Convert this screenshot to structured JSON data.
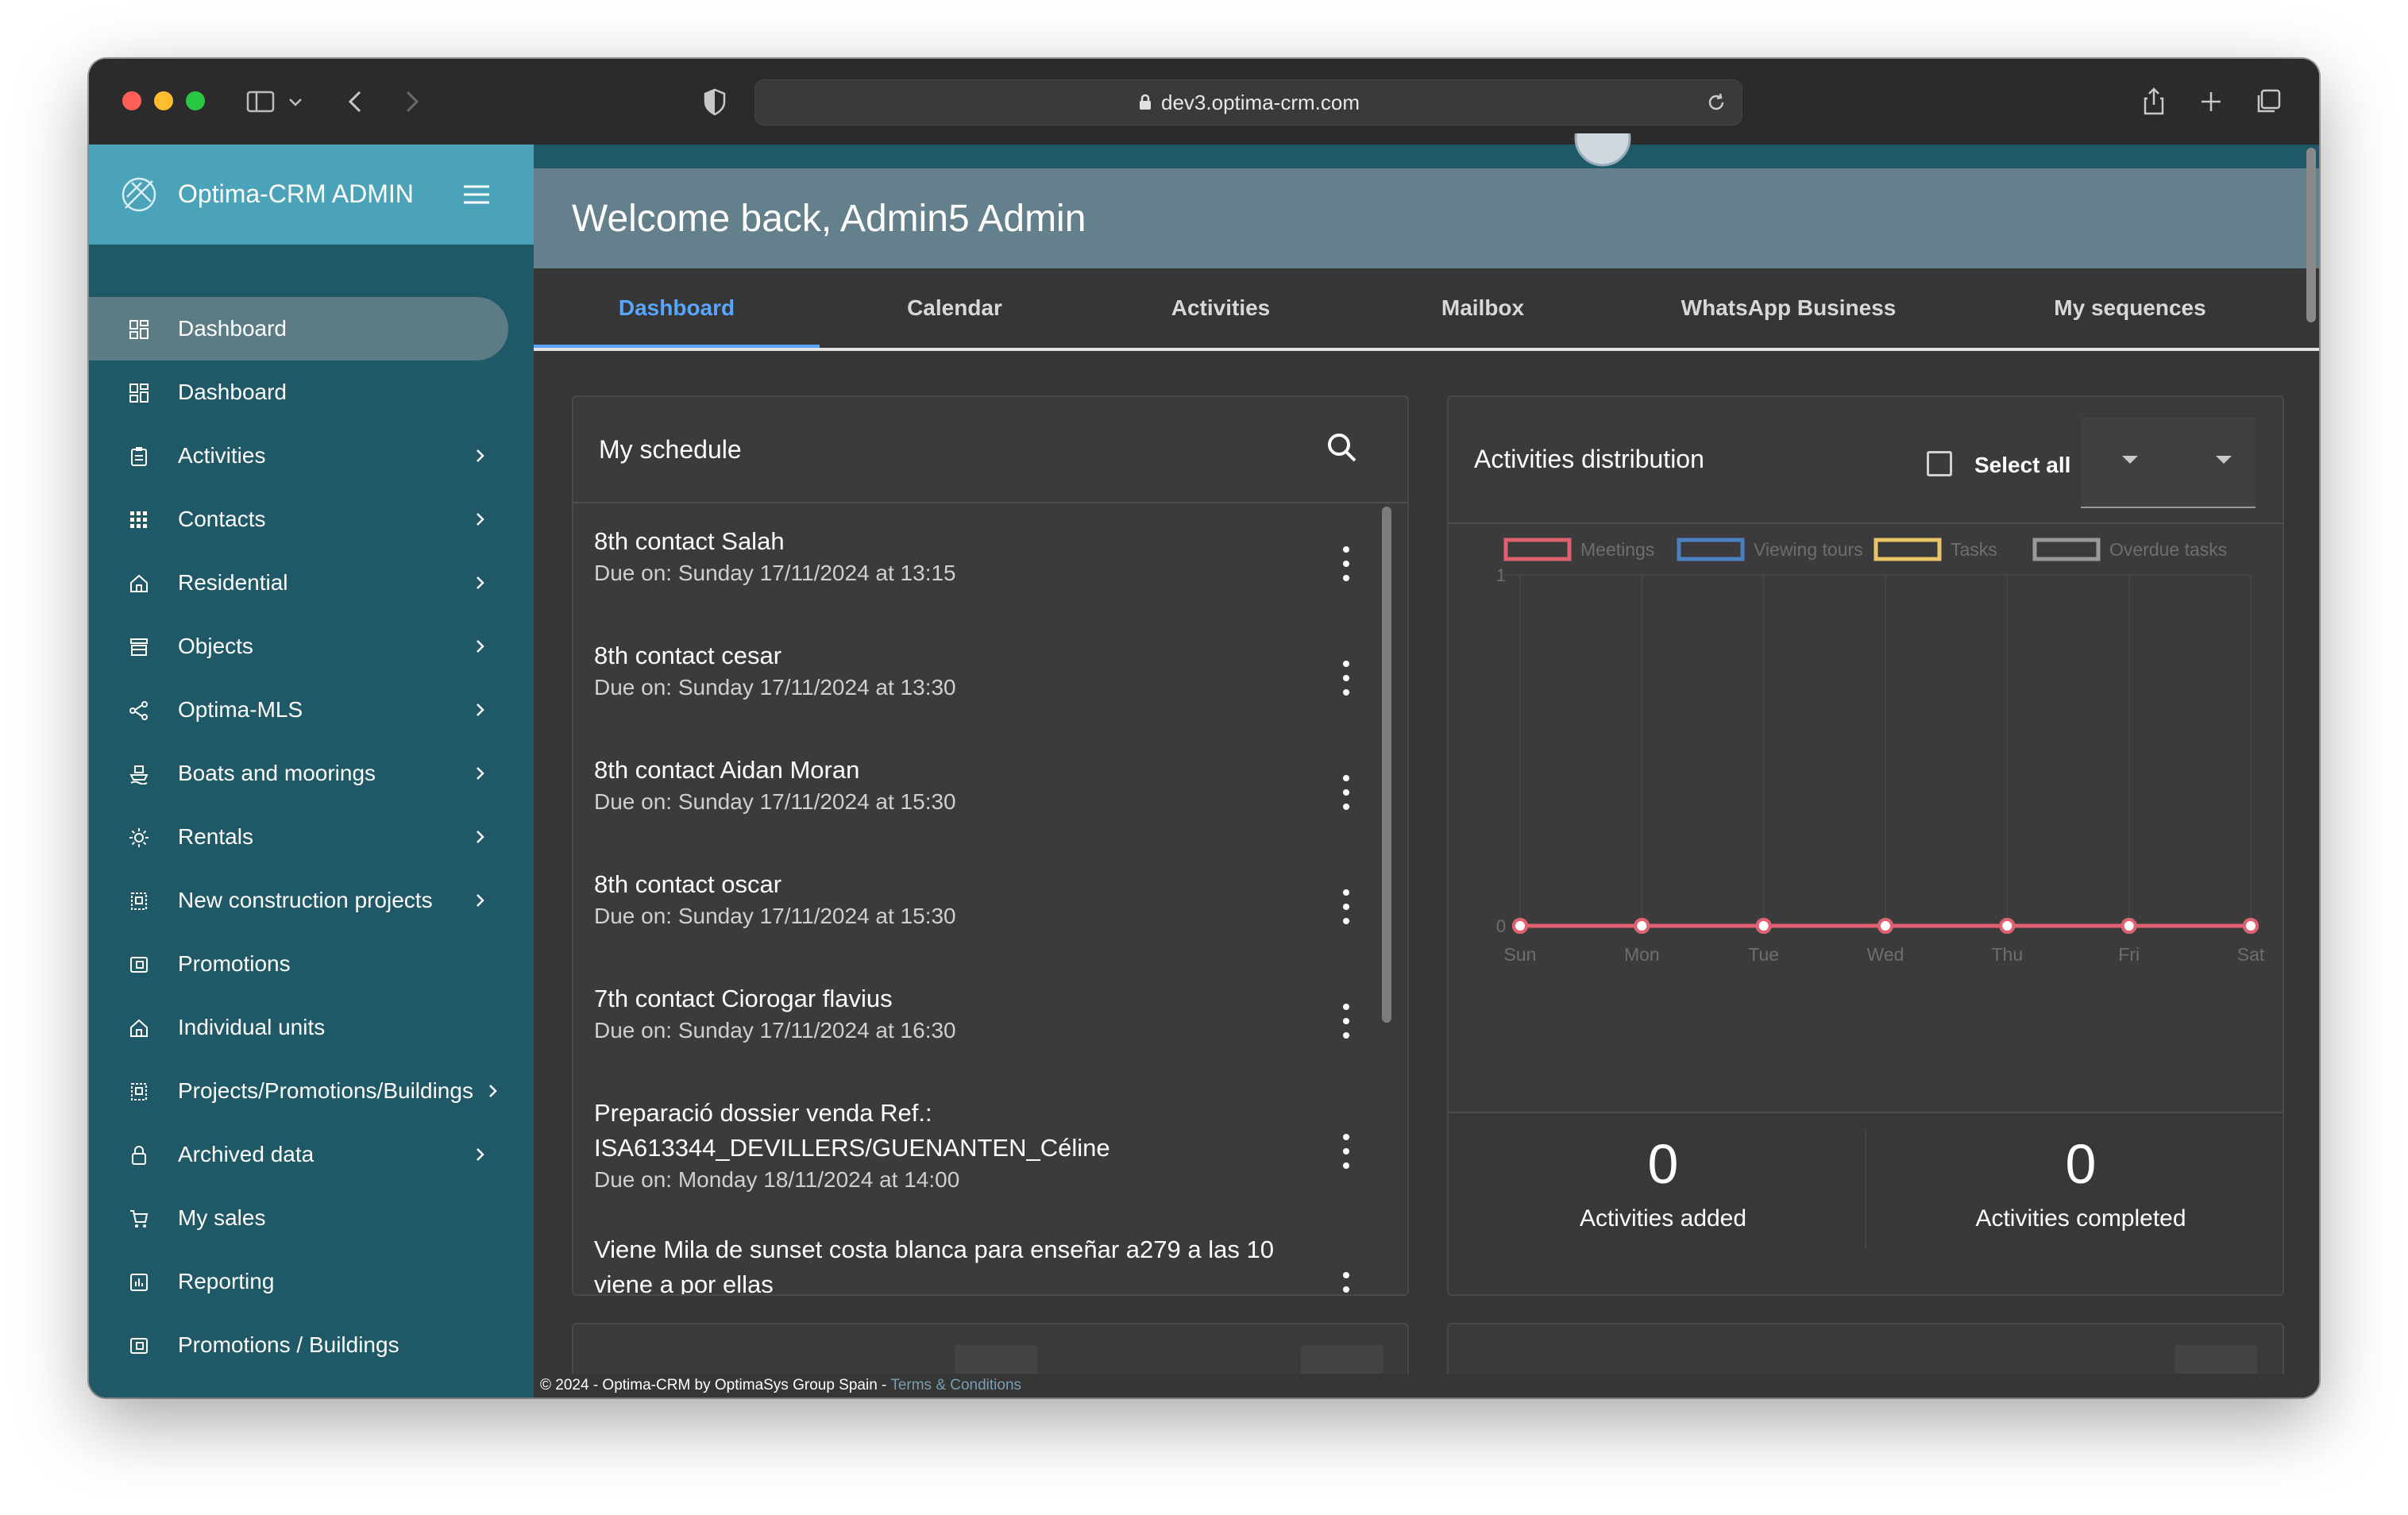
{
  "browser": {
    "url": "dev3.optima-crm.com"
  },
  "sidebar": {
    "brand": "Optima-CRM ADMIN",
    "items": [
      {
        "label": "Dashboard",
        "icon": "dashboard-icon",
        "chevron": false,
        "active": true
      },
      {
        "label": "Dashboard",
        "icon": "dashboard-icon",
        "chevron": false
      },
      {
        "label": "Activities",
        "icon": "clipboard-icon",
        "chevron": true
      },
      {
        "label": "Contacts",
        "icon": "grid-icon",
        "chevron": true
      },
      {
        "label": "Residential",
        "icon": "home-icon",
        "chevron": true
      },
      {
        "label": "Objects",
        "icon": "store-icon",
        "chevron": true
      },
      {
        "label": "Optima-MLS",
        "icon": "share-icon",
        "chevron": true
      },
      {
        "label": "Boats and moorings",
        "icon": "boat-icon",
        "chevron": true
      },
      {
        "label": "Rentals",
        "icon": "sun-icon",
        "chevron": true
      },
      {
        "label": "New construction projects",
        "icon": "building-icon",
        "chevron": true
      },
      {
        "label": "Promotions",
        "icon": "promotion-icon",
        "chevron": false
      },
      {
        "label": "Individual units",
        "icon": "home-icon",
        "chevron": false
      },
      {
        "label": "Projects/Promotions/Buildings",
        "icon": "building-icon",
        "chevron": true
      },
      {
        "label": "Archived data",
        "icon": "lock-icon",
        "chevron": true
      },
      {
        "label": "My sales",
        "icon": "cart-icon",
        "chevron": false
      },
      {
        "label": "Reporting",
        "icon": "chart-icon",
        "chevron": false
      },
      {
        "label": "Promotions / Buildings",
        "icon": "promotion-icon",
        "chevron": false
      }
    ]
  },
  "header": {
    "welcome": "Welcome back, Admin5 Admin"
  },
  "tabs": [
    {
      "label": "Dashboard",
      "active": true
    },
    {
      "label": "Calendar"
    },
    {
      "label": "Activities"
    },
    {
      "label": "Mailbox"
    },
    {
      "label": "WhatsApp Business"
    },
    {
      "label": "My sequences"
    }
  ],
  "schedule": {
    "title": "My schedule",
    "items": [
      {
        "title": "8th contact Salah",
        "due": "Due on: Sunday 17/11/2024 at 13:15"
      },
      {
        "title": "8th contact cesar",
        "due": "Due on: Sunday 17/11/2024 at 13:30"
      },
      {
        "title": "8th contact Aidan Moran",
        "due": "Due on: Sunday 17/11/2024 at 15:30"
      },
      {
        "title": "8th contact oscar",
        "due": "Due on: Sunday 17/11/2024 at 15:30"
      },
      {
        "title": "7th contact Ciorogar flavius",
        "due": "Due on: Sunday 17/11/2024 at 16:30"
      },
      {
        "title": "Preparació dossier venda Ref.: ISA613344_DEVILLERS/GUENANTEN_Céline",
        "due": "Due on: Monday 18/11/2024 at 14:00"
      },
      {
        "title": "Viene Mila de sunset costa blanca para enseñar a279 a las 10 viene a por ellas",
        "due": ""
      }
    ]
  },
  "distribution": {
    "title": "Activities distribution",
    "select_all": "Select all",
    "stats": [
      {
        "value": "0",
        "label": "Activities added"
      },
      {
        "value": "0",
        "label": "Activities completed"
      }
    ]
  },
  "chart_data": {
    "type": "line",
    "categories": [
      "Sun",
      "Mon",
      "Tue",
      "Wed",
      "Thu",
      "Fri",
      "Sat"
    ],
    "series": [
      {
        "name": "Meetings",
        "color": "#e06070",
        "values": [
          0,
          0,
          0,
          0,
          0,
          0,
          0
        ]
      },
      {
        "name": "Viewing tours",
        "color": "#4a7fc1",
        "values": [
          0,
          0,
          0,
          0,
          0,
          0,
          0
        ]
      },
      {
        "name": "Tasks",
        "color": "#e8c56a",
        "values": [
          0,
          0,
          0,
          0,
          0,
          0,
          0
        ]
      },
      {
        "name": "Overdue tasks",
        "color": "#9a9a9a",
        "values": [
          0,
          0,
          0,
          0,
          0,
          0,
          0
        ]
      }
    ],
    "ylim": [
      0,
      1
    ],
    "yticks": [
      "0",
      "1"
    ],
    "grid": true,
    "legend": "top"
  },
  "footer": {
    "text": "© 2024 - Optima-CRM by OptimaSys Group Spain - ",
    "link": "Terms & Conditions"
  }
}
